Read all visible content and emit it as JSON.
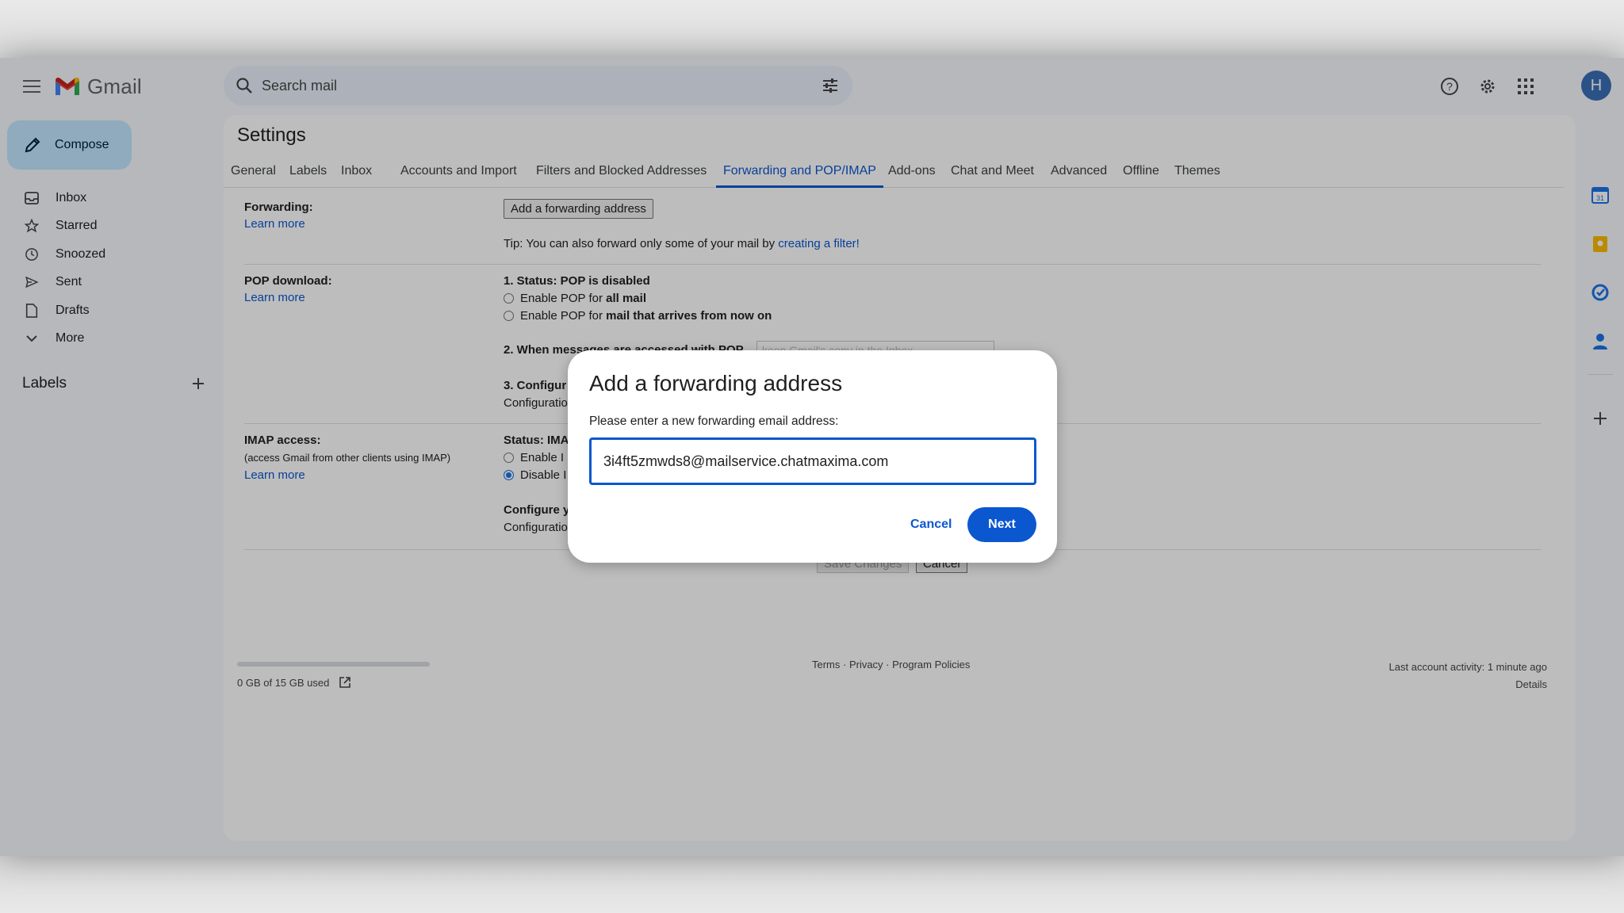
{
  "app": {
    "name": "Gmail",
    "brand_color": "#ea4335",
    "accent": "#0b57d0"
  },
  "search": {
    "placeholder": "Search mail"
  },
  "account": {
    "initial": "H",
    "avatar_color": "#3b6fb6"
  },
  "compose": {
    "label": "Compose"
  },
  "nav": {
    "items": [
      {
        "label": "Inbox",
        "icon": "inbox-icon"
      },
      {
        "label": "Starred",
        "icon": "star-icon"
      },
      {
        "label": "Snoozed",
        "icon": "clock-icon"
      },
      {
        "label": "Sent",
        "icon": "send-icon"
      },
      {
        "label": "Drafts",
        "icon": "draft-icon"
      },
      {
        "label": "More",
        "icon": "chevron-down-icon"
      }
    ],
    "labels_heading": "Labels"
  },
  "settings": {
    "title": "Settings",
    "tabs": [
      {
        "label": "General"
      },
      {
        "label": "Labels"
      },
      {
        "label": "Inbox"
      },
      {
        "label": "Accounts and Import"
      },
      {
        "label": "Filters and Blocked Addresses"
      },
      {
        "label": "Forwarding and POP/IMAP",
        "active": true
      },
      {
        "label": "Add-ons"
      },
      {
        "label": "Chat and Meet"
      },
      {
        "label": "Advanced"
      },
      {
        "label": "Offline"
      },
      {
        "label": "Themes"
      }
    ],
    "forwarding": {
      "label": "Forwarding:",
      "learn_more": "Learn more",
      "button": "Add a forwarding address",
      "tip_prefix": "Tip: You can also forward only some of your mail by",
      "tip_link": "creating a filter!"
    },
    "pop": {
      "label": "POP download:",
      "learn_more": "Learn more",
      "status": "1. Status: POP is disabled",
      "opt1_prefix": "Enable POP for",
      "opt1_bold": "all mail",
      "opt2_prefix": "Enable POP for",
      "opt2_bold": "mail that arrives from now on",
      "step2": "2. When mes",
      "step2_tail": "sages are accessed with POP",
      "step2_select": "keep Gmail's copy in the Inbox",
      "step3": "3. Configur",
      "config_link": "Configuratio"
    },
    "imap": {
      "label": "IMAP access:",
      "sublabel": "(access Gmail from other clients using IMAP)",
      "learn_more": "Learn more",
      "status": "Status: IMA",
      "opt1": "Enable I",
      "opt2": "Disable I",
      "configure": "Configure y",
      "config_link": "Configuratio"
    },
    "save_button": "Save Changes",
    "cancel_button": "Cancel"
  },
  "footer": {
    "storage": "0 GB of 15 GB used",
    "storage_used_fraction": 0,
    "links": "Terms · Privacy · Program Policies",
    "activity": "Last account activity: 1 minute ago",
    "details": "Details"
  },
  "dialog": {
    "title": "Add a forwarding address",
    "prompt": "Please enter a new forwarding email address:",
    "email_value": "3i4ft5zmwds8@mailservice.chatmaxima.com",
    "cancel": "Cancel",
    "next": "Next"
  }
}
